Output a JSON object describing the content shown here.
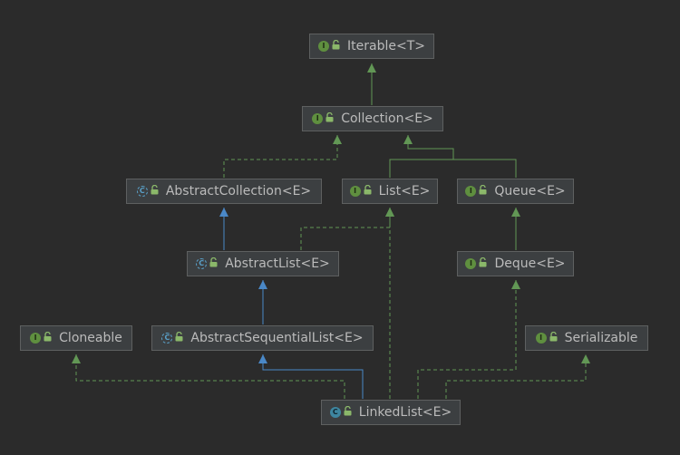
{
  "diagram": {
    "nodes": [
      {
        "id": "iterable",
        "label": "Iterable<T>",
        "kind": "interface",
        "kind_glyph": "I"
      },
      {
        "id": "collection",
        "label": "Collection<E>",
        "kind": "interface",
        "kind_glyph": "I"
      },
      {
        "id": "abstractcollection",
        "label": "AbstractCollection<E>",
        "kind": "abstract",
        "kind_glyph": "C"
      },
      {
        "id": "list",
        "label": "List<E>",
        "kind": "interface",
        "kind_glyph": "I"
      },
      {
        "id": "queue",
        "label": "Queue<E>",
        "kind": "interface",
        "kind_glyph": "I"
      },
      {
        "id": "abstractlist",
        "label": "AbstractList<E>",
        "kind": "abstract",
        "kind_glyph": "C"
      },
      {
        "id": "deque",
        "label": "Deque<E>",
        "kind": "interface",
        "kind_glyph": "I"
      },
      {
        "id": "cloneable",
        "label": "Cloneable",
        "kind": "interface",
        "kind_glyph": "I"
      },
      {
        "id": "abstractsequentiallist",
        "label": "AbstractSequentialList<E>",
        "kind": "abstract",
        "kind_glyph": "C"
      },
      {
        "id": "serializable",
        "label": "Serializable",
        "kind": "interface",
        "kind_glyph": "I"
      },
      {
        "id": "linkedlist",
        "label": "LinkedList<E>",
        "kind": "class",
        "kind_glyph": "C"
      }
    ],
    "edges": [
      {
        "from": "collection",
        "to": "iterable",
        "type": "extends"
      },
      {
        "from": "abstractcollection",
        "to": "collection",
        "type": "implements"
      },
      {
        "from": "list",
        "to": "collection",
        "type": "extends"
      },
      {
        "from": "queue",
        "to": "collection",
        "type": "extends"
      },
      {
        "from": "abstractlist",
        "to": "abstractcollection",
        "type": "extends-class"
      },
      {
        "from": "abstractlist",
        "to": "list",
        "type": "implements"
      },
      {
        "from": "deque",
        "to": "queue",
        "type": "extends"
      },
      {
        "from": "abstractsequentiallist",
        "to": "abstractlist",
        "type": "extends-class"
      },
      {
        "from": "linkedlist",
        "to": "abstractsequentiallist",
        "type": "extends-class"
      },
      {
        "from": "linkedlist",
        "to": "list",
        "type": "implements"
      },
      {
        "from": "linkedlist",
        "to": "deque",
        "type": "implements"
      },
      {
        "from": "linkedlist",
        "to": "cloneable",
        "type": "implements"
      },
      {
        "from": "linkedlist",
        "to": "serializable",
        "type": "implements"
      }
    ],
    "colors": {
      "background": "#2b2b2b",
      "node_fill": "#3c3f41",
      "node_border": "#5e6060",
      "text": "#bbbbbb",
      "interface_edge": "#629755",
      "class_edge": "#4a88c7",
      "lock_icon": "#8bb86a"
    }
  }
}
